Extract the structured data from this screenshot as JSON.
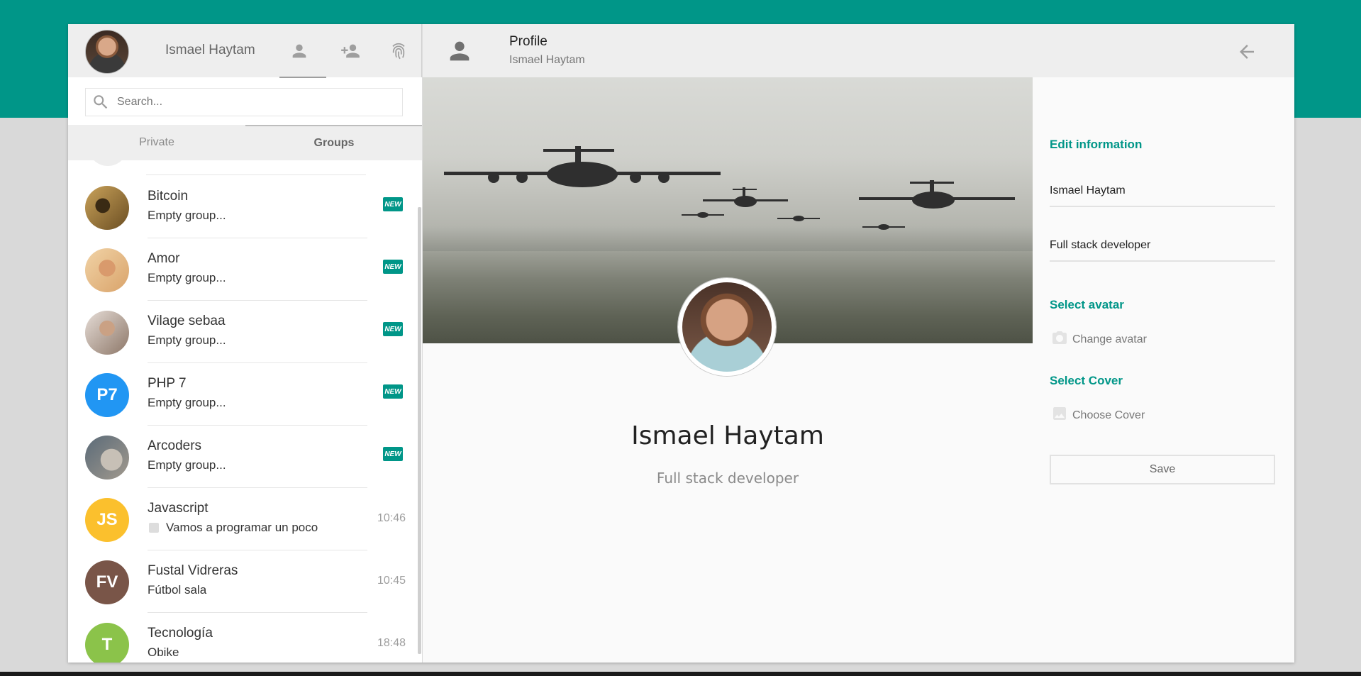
{
  "colors": {
    "accent": "#009688",
    "header_bg": "#eeeeee",
    "page_bg": "#d9d9d9"
  },
  "user": {
    "name": "Ismael Haytam"
  },
  "header_icons": [
    "person-icon",
    "person-add-icon",
    "fingerprint-icon"
  ],
  "search": {
    "placeholder": "Search..."
  },
  "tabs": [
    {
      "label": "Private"
    },
    {
      "label": "Groups"
    }
  ],
  "chats": [
    {
      "title": "Bitcoin",
      "subtitle": "Empty group...",
      "badge": "NEW",
      "avatar_color": "#b08c4a",
      "initials": ""
    },
    {
      "title": "Amor",
      "subtitle": "Empty group...",
      "badge": "NEW",
      "avatar_color": "#e9c69a",
      "initials": ""
    },
    {
      "title": "Vilage sebaa",
      "subtitle": "Empty group...",
      "badge": "NEW",
      "avatar_color": "#b9a08c",
      "initials": ""
    },
    {
      "title": "PHP 7",
      "subtitle": "Empty group...",
      "badge": "NEW",
      "avatar_color": "#2196f3",
      "initials": "P7"
    },
    {
      "title": "Arcoders",
      "subtitle": "Empty group...",
      "badge": "NEW",
      "avatar_color": "#7a8a96",
      "initials": ""
    },
    {
      "title": "Javascript",
      "subtitle": "Vamos a programar un poco",
      "time": "10:46",
      "avatar_color": "#fbc02d",
      "initials": "JS"
    },
    {
      "title": "Fustal Vidreras",
      "subtitle": "Fútbol sala",
      "time": "10:45",
      "avatar_color": "#795548",
      "initials": "FV"
    },
    {
      "title": "Tecnología",
      "subtitle": "Obike",
      "time": "18:48",
      "avatar_color": "#8bc34a",
      "initials": "T"
    }
  ],
  "profile_header": {
    "title": "Profile",
    "subtitle": "Ismael Haytam"
  },
  "profile": {
    "name": "Ismael Haytam",
    "description": "Full stack developer"
  },
  "edit": {
    "edit_title": "Edit information",
    "name_value": "Ismael Haytam",
    "description_value": "Full stack developer",
    "avatar_title": "Select avatar",
    "change_avatar": "Change avatar",
    "cover_title": "Select Cover",
    "choose_cover": "Choose Cover",
    "save_label": "Save"
  }
}
